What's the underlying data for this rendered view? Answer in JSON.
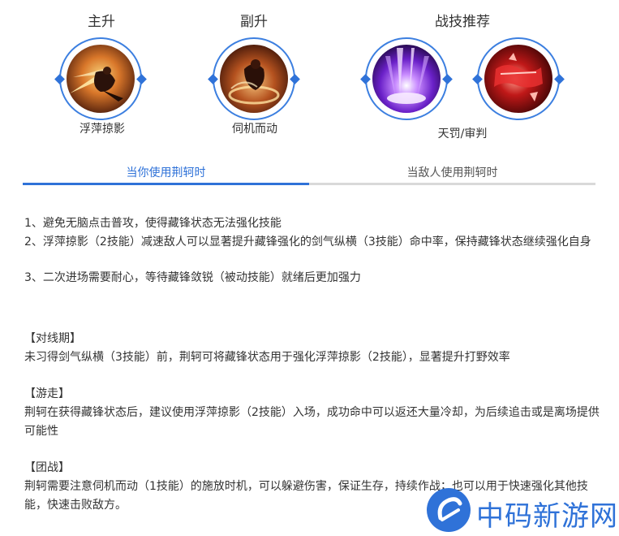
{
  "columns": {
    "main": "主升",
    "sub": "副升",
    "battle": "战技推荐"
  },
  "skills": {
    "main_name": "浮萍掠影",
    "sub_name": "伺机而动",
    "battle_name": "天罚/审判"
  },
  "tabs": [
    {
      "label": "当你使用荆轲时"
    },
    {
      "label": "当敌人使用荆轲时"
    }
  ],
  "tips": [
    "1、避免无脑点击普攻，使得藏锋状态无法强化技能",
    "2、浮萍掠影（2技能）减速敌人可以显著提升藏锋强化的剑气纵横（3技能）命中率，保持藏锋状态继续强化自身",
    "3、二次进场需要耐心，等待藏锋敛锐（被动技能）就绪后更加强力"
  ],
  "phases": [
    {
      "heading": "【对线期】",
      "text": "未习得剑气纵横（3技能）前，荆轲可将藏锋状态用于强化浮萍掠影（2技能），显著提升打野效率"
    },
    {
      "heading": "【游走】",
      "text": "荆轲在获得藏锋状态后，建议使用浮萍掠影（2技能）入场，成功命中可以返还大量冷却，为后续追击或是离场提供可能性"
    },
    {
      "heading": "【团战】",
      "text": "荆轲需要注意伺机而动（1技能）的施放时机，可以躲避伤害，保证生存，持续作战；也可以用于快速强化其他技能，快速击败敌方。"
    }
  ],
  "watermark": "中码新游网",
  "colors": {
    "accent": "#2f72d8",
    "inactive_line": "#d9d9d9"
  }
}
